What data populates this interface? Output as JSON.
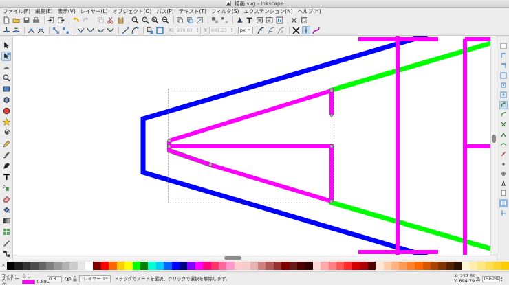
{
  "window": {
    "title": "描画.svg - Inkscape"
  },
  "menu": [
    "ファイル(F)",
    "編集(E)",
    "表示(V)",
    "レイヤー(L)",
    "オブジェクト(O)",
    "パス(P)",
    "テキスト(T)",
    "フィルタ(S)",
    "エクステンション(N)",
    "ヘルプ(H)"
  ],
  "toolcontrols": {
    "x_label": "X:",
    "x_value": "270.02",
    "y_label": "Y:",
    "y_value": "681.23",
    "unit": "px"
  },
  "status": {
    "fill_label": "フィル:",
    "fill_value": "なし",
    "stroke_label": "ストローク:",
    "stroke_width": "0.886",
    "opacity": "0.3",
    "layer": "·レイヤー 1",
    "message": "ドラッグでノードを選択、クリックで選択を解除します。",
    "x_readout": "X: 257.59",
    "y_readout": "Y: 694.79",
    "zoom_label": "Z:",
    "zoom_value": "1562%"
  },
  "colors": {
    "blue": "#0000ff",
    "magenta": "#ff00ff",
    "green": "#00ff00",
    "accent": "#4a86c8"
  },
  "palette": [
    "#000000",
    "#1a1a1a",
    "#333333",
    "#4d4d4d",
    "#666666",
    "#808080",
    "#999999",
    "#b3b3b3",
    "#cccccc",
    "#e6e6e6",
    "#ffffff",
    "#800000",
    "#ff0000",
    "#ff6600",
    "#ffcc00",
    "#ffff00",
    "#00ff00",
    "#008000",
    "#00ffcc",
    "#00ccff",
    "#0066ff",
    "#0000ff",
    "#000080",
    "#8000ff",
    "#ff00ff",
    "#ff0080",
    "#ff3366",
    "#ff6699",
    "#ff99cc",
    "#ffcccc",
    "#f4cccc",
    "#e6b3b3",
    "#cc8080",
    "#b35959",
    "#993333",
    "#800000",
    "#661a1a",
    "#4d0000",
    "#330000",
    "#ffd5d5",
    "#ffaaaa",
    "#ff8080",
    "#ff5555",
    "#ff2a2a",
    "#d40000",
    "#aa0000",
    "#550000",
    "#ffe6d5",
    "#ffccaa",
    "#ffb380",
    "#ff9955",
    "#ff7f2a",
    "#ff6600",
    "#d45500",
    "#aa4400",
    "#803300",
    "#552200",
    "#2b1100",
    "#fff6d5",
    "#ffeeaa",
    "#ffe680",
    "#ffdd55",
    "#ffd42a",
    "#ffcc00"
  ],
  "icons": {
    "toolbox": [
      "selector-icon",
      "node-tool-icon",
      "tweak-icon",
      "zoom-icon",
      "rectangle-icon",
      "3d-box-icon",
      "circle-icon",
      "star-icon",
      "spiral-icon",
      "pencil-icon",
      "pen-icon",
      "calligraphy-icon",
      "text-icon",
      "spray-icon",
      "eraser-icon",
      "paint-bucket-icon",
      "gradient-icon",
      "mesh-icon",
      "dropper-icon",
      "connector-icon"
    ]
  }
}
